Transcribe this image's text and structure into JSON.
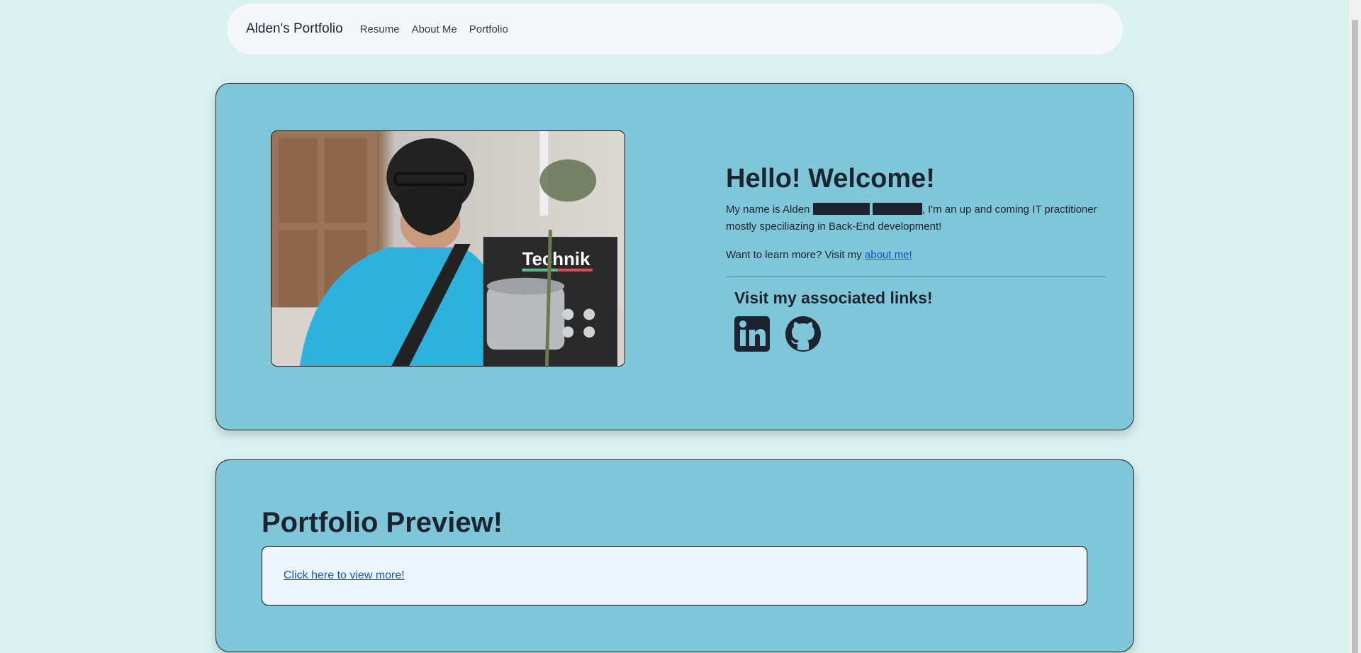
{
  "nav": {
    "brand": "Alden's Portfolio",
    "links": [
      "Resume",
      "About Me",
      "Portfolio"
    ]
  },
  "hero": {
    "photo_text": "Technik",
    "title": "Hello! Welcome!",
    "intro_before": "My name is Alden ",
    "intro_after": ", I'm an up and coming IT practitioner mostly speciliazing in Back-End development!",
    "learn_prefix": "Want to learn more? Visit my ",
    "learn_link": "about me!",
    "links_title": "Visit my associated links!"
  },
  "preview": {
    "title": "Portfolio Preview!",
    "link": "Click here to view more!"
  },
  "colors": {
    "page_bg": "#daf1ef",
    "card_bg": "#7fc6d9",
    "navbar_bg": "#f5f8fa",
    "link": "#1a4fd8",
    "icon": "#1d2430"
  }
}
